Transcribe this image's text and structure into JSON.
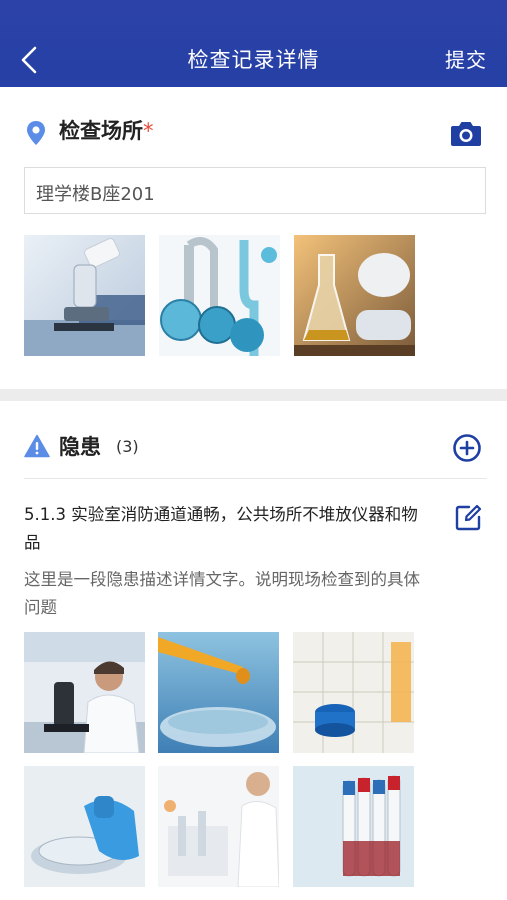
{
  "header": {
    "title": "检查记录详情",
    "submit_label": "提交",
    "back_icon": "back-chevron-icon"
  },
  "location": {
    "label": "检查场所",
    "required_mark": "*",
    "value": "理学楼B座201",
    "icon": "location-pin-icon",
    "camera_icon": "camera-icon",
    "photos": [
      "microscope-photo",
      "glassware-photo",
      "flask-photo"
    ]
  },
  "hazards": {
    "label": "隐患",
    "count": "(3)",
    "icon": "warning-icon",
    "add_icon": "add-circle-icon",
    "item": {
      "title": "5.1.3  实验室消防通道通畅，公共场所不堆放仪器和物品",
      "description": "这里是一段隐患描述详情文字。说明现场检查到的具体问题",
      "edit_icon": "edit-icon",
      "photos": [
        "scientist-microscope-photo",
        "pipette-drop-photo",
        "periodic-table-bottle-photo",
        "petri-dish-photo",
        "lab-worker-photo",
        "test-tubes-photo"
      ]
    }
  },
  "colors": {
    "brand": "#2a41a7",
    "accent_icon": "#1f3fa2",
    "location_icon": "#5b8de6",
    "required": "#e64b3c"
  }
}
